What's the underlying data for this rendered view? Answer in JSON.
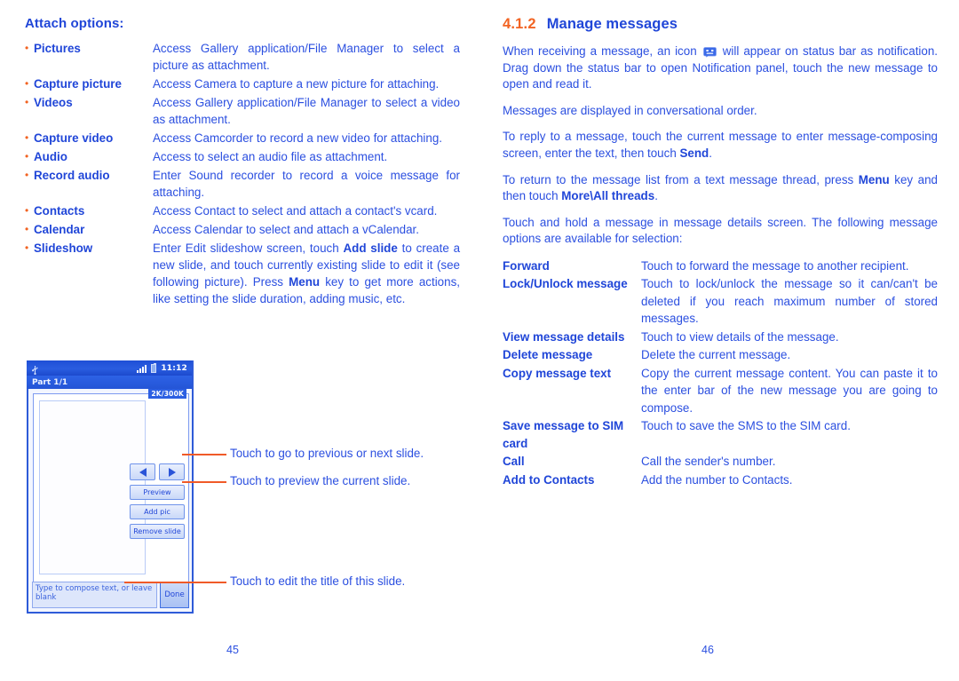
{
  "colors": {
    "primary_blue": "#2046d8",
    "body_blue": "#2b4fe0",
    "accent_orange": "#f26322",
    "callout_orange": "#f05a28"
  },
  "left_page": {
    "page_number": "45",
    "heading": "Attach options:",
    "attach_options": [
      {
        "term": "Pictures",
        "desc": "Access Gallery application/File Manager to select a picture as attachment."
      },
      {
        "term": "Capture picture",
        "desc": "Access Camera to capture a new picture for attaching."
      },
      {
        "term": "Videos",
        "desc": "Access Gallery application/File Manager to select a video as attachment."
      },
      {
        "term": "Capture video",
        "desc": "Access Camcorder to record a new video for attaching."
      },
      {
        "term": "Audio",
        "desc": "Access to select an audio file as attachment."
      },
      {
        "term": "Record audio",
        "desc": "Enter Sound recorder to record a voice message for attaching."
      },
      {
        "term": "Contacts",
        "desc": "Access Contact to select and attach a contact's vcard."
      },
      {
        "term": "Calendar",
        "desc": "Access Calendar to select and attach a vCalendar."
      },
      {
        "term": "Slideshow",
        "desc_parts": [
          {
            "text": "Enter Edit slideshow screen, touch ",
            "bold": false
          },
          {
            "text": "Add slide",
            "bold": true
          },
          {
            "text": " to create a new slide, and touch currently existing slide to edit it (see following picture). Press ",
            "bold": false
          },
          {
            "text": "Menu",
            "bold": true
          },
          {
            "text": " key to get more actions, like setting the slide duration, adding music, etc.",
            "bold": false
          }
        ]
      }
    ],
    "phone_figure": {
      "status_bar": {
        "usb_icon": "usb-icon",
        "signal_icon": "signal-bars-icon",
        "battery_icon": "battery-icon",
        "time": "11:12"
      },
      "title_bar": "Part 1/1",
      "size_badge": "2K/300K",
      "buttons": {
        "prev": "previous-slide-arrow",
        "next": "next-slide-arrow",
        "preview": "Preview",
        "add_pic": "Add pic",
        "remove_slide": "Remove slide"
      },
      "compose_placeholder": "Type to compose text, or leave blank",
      "done_label": "Done"
    },
    "callouts": [
      "Touch to go to previous or next slide.",
      "Touch to preview the current slide.",
      "Touch to edit the title of this slide."
    ]
  },
  "right_page": {
    "page_number": "46",
    "section_number": "4.1.2",
    "section_title": "Manage messages",
    "paragraphs": {
      "p1_before_icon": "When receiving a message, an icon ",
      "p1_icon_name": "message-smiley-icon",
      "p1_after_icon": " will appear on status bar as notification. Drag down the status bar to open Notification panel, touch the new message to open and read it.",
      "p2": "Messages are displayed in conversational order.",
      "p3_parts": [
        {
          "text": "To reply to a message, touch the current message to enter message-composing screen, enter the text, then touch ",
          "bold": false
        },
        {
          "text": "Send",
          "bold": true
        },
        {
          "text": ".",
          "bold": false
        }
      ],
      "p4_parts": [
        {
          "text": "To return to the message list from a text message thread, press ",
          "bold": false
        },
        {
          "text": "Menu",
          "bold": true
        },
        {
          "text": " key and then touch ",
          "bold": false
        },
        {
          "text": "More\\All threads",
          "bold": true
        },
        {
          "text": ".",
          "bold": false
        }
      ],
      "p5": "Touch and hold a message in message details screen. The following message options are available for selection:"
    },
    "message_options": [
      {
        "term": "Forward",
        "desc": "Touch to forward the message to another recipient."
      },
      {
        "term": "Lock/Unlock message",
        "desc": "Touch to lock/unlock the message so it can/can't be deleted if you reach maximum number of stored messages."
      },
      {
        "term": "View message details",
        "desc": "Touch to view details of the message."
      },
      {
        "term": "Delete message",
        "desc": "Delete the current message."
      },
      {
        "term": "Copy message text",
        "desc": "Copy the current message content. You can paste it to the enter bar of the new message you are going to compose."
      },
      {
        "term": "Save message to SIM card",
        "desc": "Touch to save the SMS to the SIM card."
      },
      {
        "term": "Call",
        "desc": "Call the sender's number."
      },
      {
        "term": "Add to Contacts",
        "desc": "Add the number to Contacts."
      }
    ]
  }
}
